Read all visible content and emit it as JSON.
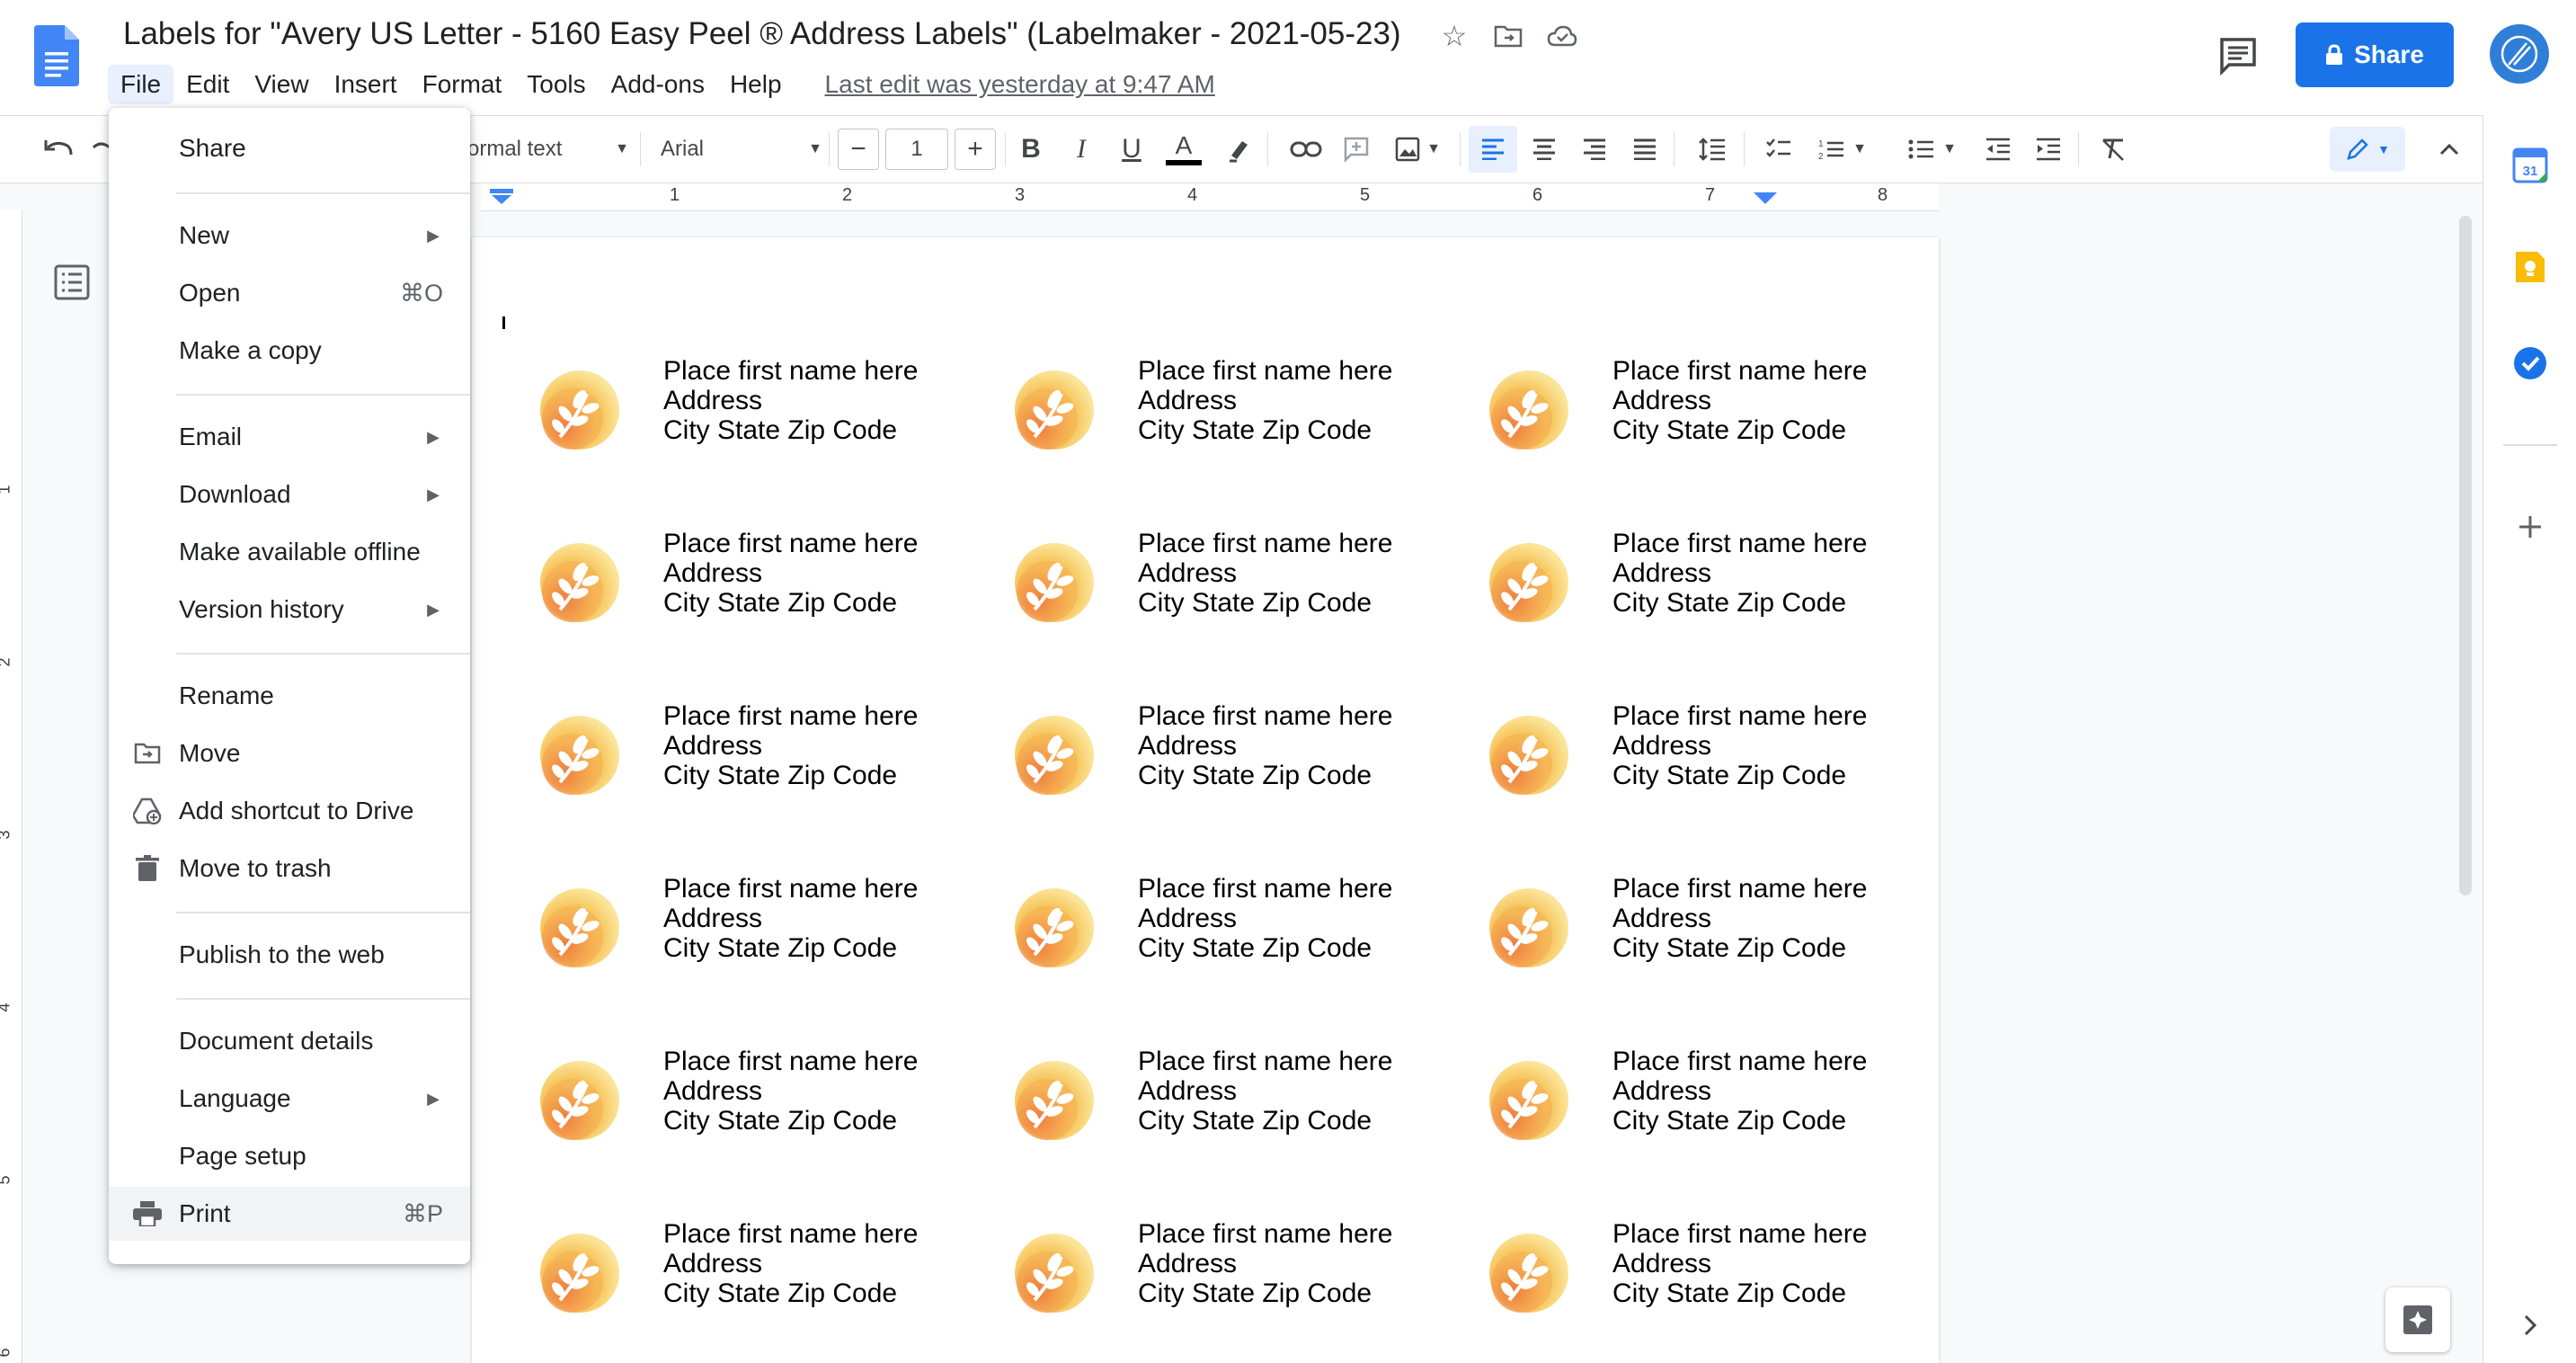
{
  "app": {
    "title": "Labels for \"Avery US Letter - 5160 Easy Peel ® Address Labels\" (Labelmaker - 2021-05-23)",
    "menus": [
      "File",
      "Edit",
      "View",
      "Insert",
      "Format",
      "Tools",
      "Add-ons",
      "Help"
    ],
    "last_edit": "Last edit was yesterday at 9:47 AM",
    "share_label": "Share",
    "accent_color": "#1a73e8"
  },
  "toolbar": {
    "style_value": "ormal text",
    "font_value": "Arial",
    "font_size": "1",
    "icons": [
      "undo-icon",
      "redo-icon",
      "bold-icon",
      "italic-icon",
      "underline-icon",
      "text-color-icon",
      "highlight-icon",
      "link-icon",
      "comment-icon",
      "image-icon",
      "align-left-icon",
      "align-center-icon",
      "align-right-icon",
      "justify-icon",
      "line-spacing-icon",
      "checklist-icon",
      "numbered-list-icon",
      "bulleted-list-icon",
      "decrease-indent-icon",
      "increase-indent-icon",
      "clear-formatting-icon",
      "editing-mode-icon",
      "collapse-icon"
    ]
  },
  "ruler": {
    "numbers": [
      "1",
      "2",
      "3",
      "4",
      "5",
      "6",
      "7",
      "8"
    ]
  },
  "v_ruler": {
    "numbers": [
      "1",
      "2",
      "3",
      "4",
      "5",
      "6"
    ]
  },
  "file_menu": {
    "share": "Share",
    "new": "New",
    "open": "Open",
    "open_shortcut": "⌘O",
    "make_copy": "Make a copy",
    "email": "Email",
    "download": "Download",
    "offline": "Make available offline",
    "version_history": "Version history",
    "rename": "Rename",
    "move": "Move",
    "add_shortcut": "Add shortcut to Drive",
    "trash": "Move to trash",
    "publish": "Publish to the web",
    "details": "Document details",
    "language": "Language",
    "page_setup": "Page setup",
    "print": "Print",
    "print_shortcut": "⌘P"
  },
  "label": {
    "name": "Place first name here",
    "address": "Address",
    "city": "City State Zip Code"
  },
  "side_panel": {
    "calendar_day": "31"
  }
}
